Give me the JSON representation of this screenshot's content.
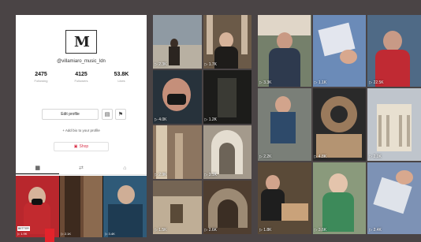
{
  "profile": {
    "logo_text": "M",
    "handle": "@villamiaro_music_ldn",
    "stats": [
      {
        "value": "2475",
        "label": "Following"
      },
      {
        "value": "4125",
        "label": "Followers"
      },
      {
        "value": "53.8K",
        "label": "Likes"
      }
    ],
    "edit_label": "Edit profile",
    "add_bio": "+ Add bio to your profile",
    "shop_label": "Shop",
    "tabs": [
      {
        "icon": "grid-icon",
        "glyph": "▦"
      },
      {
        "icon": "repost-icon",
        "glyph": "⇄"
      },
      {
        "icon": "lock-icon",
        "glyph": "⌂"
      }
    ],
    "thumbs": [
      {
        "views": "▷ 1.9K",
        "color": "#b8272d",
        "label": "BETTER"
      },
      {
        "views": "▷ 2.1K",
        "color": "#6b4a35",
        "label": ""
      },
      {
        "views": "▷ 3.4K",
        "color": "#2f5a78",
        "label": ""
      }
    ]
  },
  "middle": {
    "tiles": [
      {
        "views": "▷ 2.3K",
        "bg": "#8f9aa3",
        "accent": "#d8d3c8"
      },
      {
        "views": "▷ 1.7K",
        "bg": "#6b5a48",
        "accent": "#c9b6a0"
      },
      {
        "views": "▷ 4.0K",
        "bg": "#27323b",
        "accent": "#c58f7a"
      },
      {
        "views": "▷ 1.2K",
        "bg": "#1c1c1a",
        "accent": "#3a3a34"
      },
      {
        "views": "▷ 2.9K",
        "bg": "#8c7560",
        "accent": "#d9c9b0"
      },
      {
        "views": "▷ 3.1K",
        "bg": "#a49a8c",
        "accent": "#e4ddd0"
      },
      {
        "views": "▷ 1.5K",
        "bg": "#756554",
        "accent": "#bfae96"
      },
      {
        "views": "▷ 2.6K",
        "bg": "#4f3e30",
        "accent": "#9c8a74"
      }
    ]
  },
  "right": {
    "tiles": [
      {
        "views": "▷ 3.3K",
        "bg": "#75806b",
        "accent": "#e0d6c8"
      },
      {
        "views": "▷ 1.1K",
        "bg": "#6b8bb8",
        "accent": "#e3e6ee"
      },
      {
        "views": "▷ 22.5K",
        "bg": "#4f6a86",
        "accent": "#c89a86"
      },
      {
        "views": "▷ 2.2K",
        "bg": "#7a7f78",
        "accent": "#2e4a6a"
      },
      {
        "views": "▷ 4.8K",
        "bg": "#2a2a2a",
        "accent": "#9a7a5c"
      },
      {
        "views": "▷ 2.0K",
        "bg": "#bfc5cc",
        "accent": "#e8e0d0"
      },
      {
        "views": "▷ 1.8K",
        "bg": "#5a4a38",
        "accent": "#c9a27a"
      },
      {
        "views": "▷ 3.6K",
        "bg": "#8a9a7c",
        "accent": "#e4d4c4"
      },
      {
        "views": "▷ 2.4K",
        "bg": "#7d92b5",
        "accent": "#dfe3ea"
      }
    ]
  },
  "marker_color": "#e3232b"
}
